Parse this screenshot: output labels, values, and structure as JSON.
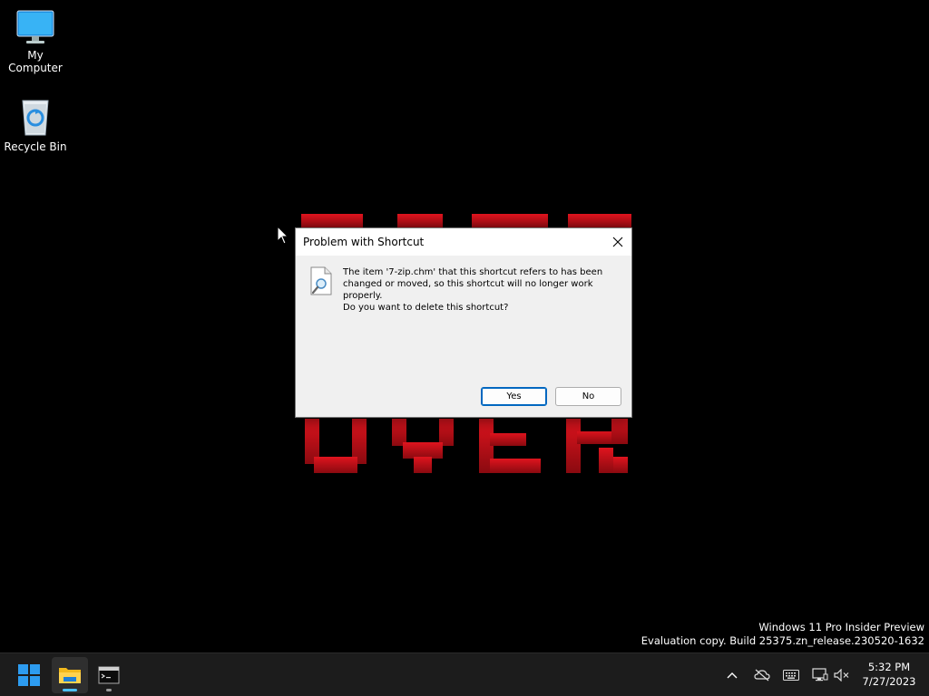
{
  "desktop": {
    "icons": [
      {
        "label": "My Computer"
      },
      {
        "label": "Recycle Bin"
      }
    ],
    "wallpaper_text": "GAME OVER",
    "wallpaper_color": "#c8101a"
  },
  "dialog": {
    "title": "Problem with Shortcut",
    "message": "The item '7-zip.chm' that this shortcut refers to has been changed or moved, so this shortcut will no longer work properly.",
    "question": "Do you want to delete this shortcut?",
    "buttons": {
      "yes": "Yes",
      "no": "No"
    },
    "icon": "document-search-icon"
  },
  "watermark": {
    "line1": "Windows 11 Pro Insider Preview",
    "line2": "Evaluation copy. Build 25375.zn_release.230520-1632"
  },
  "taskbar": {
    "apps": [
      {
        "name": "start",
        "icon": "windows-logo-icon"
      },
      {
        "name": "file-explorer",
        "icon": "folder-icon",
        "active": true
      },
      {
        "name": "terminal",
        "icon": "terminal-icon",
        "running": true
      }
    ],
    "tray_icons": [
      "chevron-up-icon",
      "onedrive-icon",
      "keyboard-icon",
      "network-icon",
      "volume-muted-icon"
    ],
    "clock": {
      "time": "5:32 PM",
      "date": "7/27/2023"
    },
    "accent": "#0078d4"
  }
}
